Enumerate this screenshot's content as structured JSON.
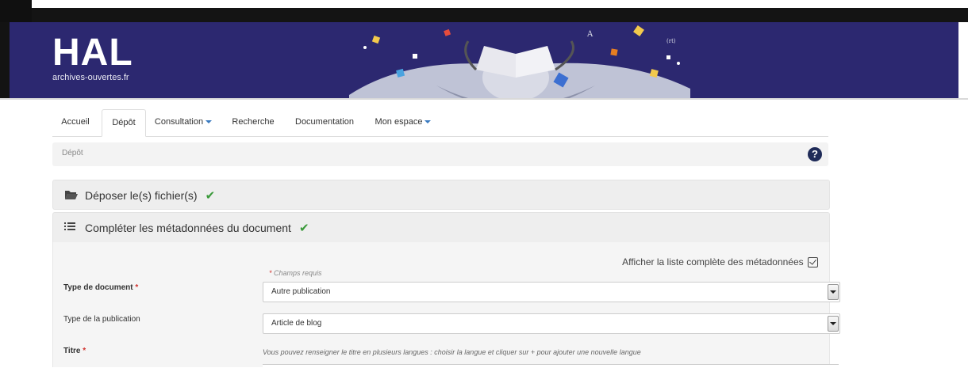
{
  "brand": {
    "logo_text": "HAL",
    "tagline": "archives-ouvertes.fr"
  },
  "nav": {
    "tabs": [
      {
        "label": "Accueil"
      },
      {
        "label": "Dépôt"
      },
      {
        "label": "Consultation"
      },
      {
        "label": "Recherche"
      },
      {
        "label": "Documentation"
      },
      {
        "label": "Mon espace"
      }
    ],
    "active_tab": "Dépôt"
  },
  "breadcrumb": {
    "current": "Dépôt",
    "help_label": "?"
  },
  "panels": {
    "deposit": {
      "title": "Déposer le(s) fichier(s)",
      "status": "✔"
    },
    "metadata": {
      "title": "Compléter les métadonnées du document",
      "status": "✔"
    }
  },
  "form": {
    "show_all_metadata": "Afficher la liste complète des métadonnées",
    "required_note": "Champs requis",
    "required_mark": "*",
    "document_type": {
      "label": "Type de document",
      "value": "Autre publication"
    },
    "publication_type": {
      "label": "Type de la publication",
      "value": "Article de blog"
    },
    "title": {
      "label": "Titre",
      "hint": "Vous pouvez renseigner le titre en plusieurs langues : choisir la langue et cliquer sur + pour ajouter une nouvelle langue"
    }
  },
  "colors": {
    "banner": "#2c2870",
    "success_check": "#3a9a3a",
    "required_star": "#d0322e",
    "help_icon": "#1f2b58",
    "caret": "#3a7bc0"
  }
}
